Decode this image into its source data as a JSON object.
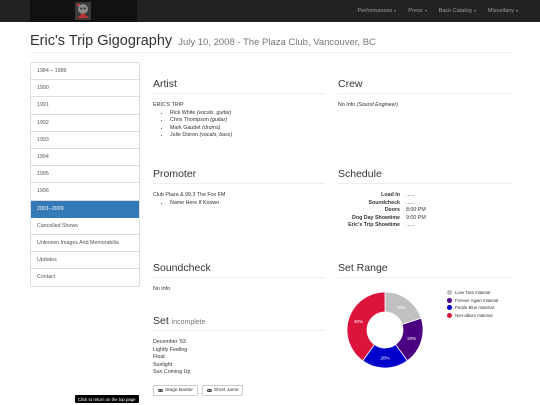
{
  "navbar": {
    "items": [
      {
        "label": "Performances"
      },
      {
        "label": "Press"
      },
      {
        "label": "Back Catalog"
      },
      {
        "label": "Miscellany"
      }
    ]
  },
  "header": {
    "title": "Eric's Trip Gigography",
    "subtitle": "July 10, 2008 - The Plaza Club, Vancouver, BC"
  },
  "sidebar": {
    "items": [
      {
        "label": "1984 – 1989"
      },
      {
        "label": "1990"
      },
      {
        "label": "1991"
      },
      {
        "label": "1992"
      },
      {
        "label": "1993"
      },
      {
        "label": "1994"
      },
      {
        "label": "1995"
      },
      {
        "label": "1996"
      },
      {
        "label": "2001–2009",
        "active": true
      },
      {
        "label": "Cancelled Shows"
      },
      {
        "label": "Unknown Images And Memorabilia"
      },
      {
        "label": "Updates"
      },
      {
        "label": "Contact"
      }
    ]
  },
  "artist": {
    "heading": "Artist",
    "band": "ERIC'S TRIP",
    "members": [
      {
        "name": "Rick White",
        "role": "(vocals, guitar)"
      },
      {
        "name": "Chris Thompson",
        "role": "(guitar)"
      },
      {
        "name": "Mark Gaudet",
        "role": "(drums)"
      },
      {
        "name": "Julie Doiron",
        "role": "(vocals, bass)"
      }
    ]
  },
  "crew": {
    "heading": "Crew",
    "name": "No Info",
    "role": "(Sound Engineer)"
  },
  "promoter": {
    "heading": "Promoter",
    "name": "Club Plaza & 99.3 The Fox FM",
    "contacts": [
      "Name Here If Known"
    ]
  },
  "schedule": {
    "heading": "Schedule",
    "rows": [
      {
        "label": "Load In",
        "value": "......"
      },
      {
        "label": "Soundcheck",
        "value": "......"
      },
      {
        "label": "Doors",
        "value": "8:00 PM"
      },
      {
        "label": "Dog Day Showtime",
        "value": "9:00 PM"
      },
      {
        "label": "Eric's Trip Showtime",
        "value": "......"
      }
    ]
  },
  "soundcheck": {
    "heading": "Soundcheck",
    "text": "No Info"
  },
  "setlist": {
    "heading": "Set",
    "status": "incomplete",
    "songs": [
      "December '93",
      "Lightly Feeling",
      "Float",
      "Sunlight",
      "Sun Coming Up"
    ],
    "buttons": [
      {
        "label": "Stage Banter",
        "icon": "eye-icon"
      },
      {
        "label": "Short Jams",
        "icon": "eye-icon"
      }
    ]
  },
  "set_range": {
    "heading": "Set Range"
  },
  "chart_data": {
    "type": "pie",
    "categories": [
      "Love Tara material",
      "Forever Again material",
      "Purple Blue material",
      "Non-album material"
    ],
    "values": [
      20,
      20,
      20,
      40
    ],
    "labels": [
      "20%",
      "20%",
      "20%",
      "40%"
    ],
    "colors": [
      "#c0c0c0",
      "#4b0082",
      "#0000cd",
      "#dc143c"
    ],
    "donut": true,
    "legend_position": "right"
  },
  "tooltip": {
    "text": "Click to return on the top page"
  }
}
